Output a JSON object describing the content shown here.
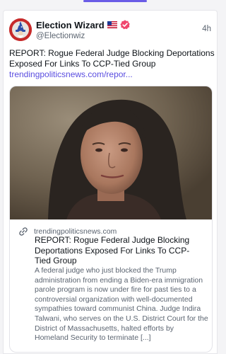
{
  "post": {
    "author_name": "Election Wizard",
    "handle": "@Electionwiz",
    "timestamp": "4h",
    "text": "REPORT: Rogue Federal Judge Blocking Deportations Exposed For Links To CCP-Tied Group",
    "link": "trendingpoliticsnews.com/repor..."
  },
  "link_card": {
    "domain": "trendingpoliticsnews.com",
    "title": "REPORT: Rogue Federal Judge Blocking Deportations Exposed For Links To CCP-Tied Group",
    "description": "A federal judge who just blocked the Trump administration from ending a Biden-era immigration parole program is now under fire for past ties to a controversial organization with well-documented sympathies toward communist China. Judge Indira Talwani, who serves on the U.S. District Court for the District of Massachusetts, halted efforts by Homeland Security to terminate [...]"
  },
  "icons": {
    "avatar": "wizard-avatar",
    "flag": "us-flag-icon",
    "badge": "verified-badge-icon",
    "link": "link-chain-icon"
  },
  "colors": {
    "accent": "#6a5ce6",
    "link": "#5a4de0",
    "verified": "#f0466d",
    "avatar_bg": "#c72a2a"
  }
}
